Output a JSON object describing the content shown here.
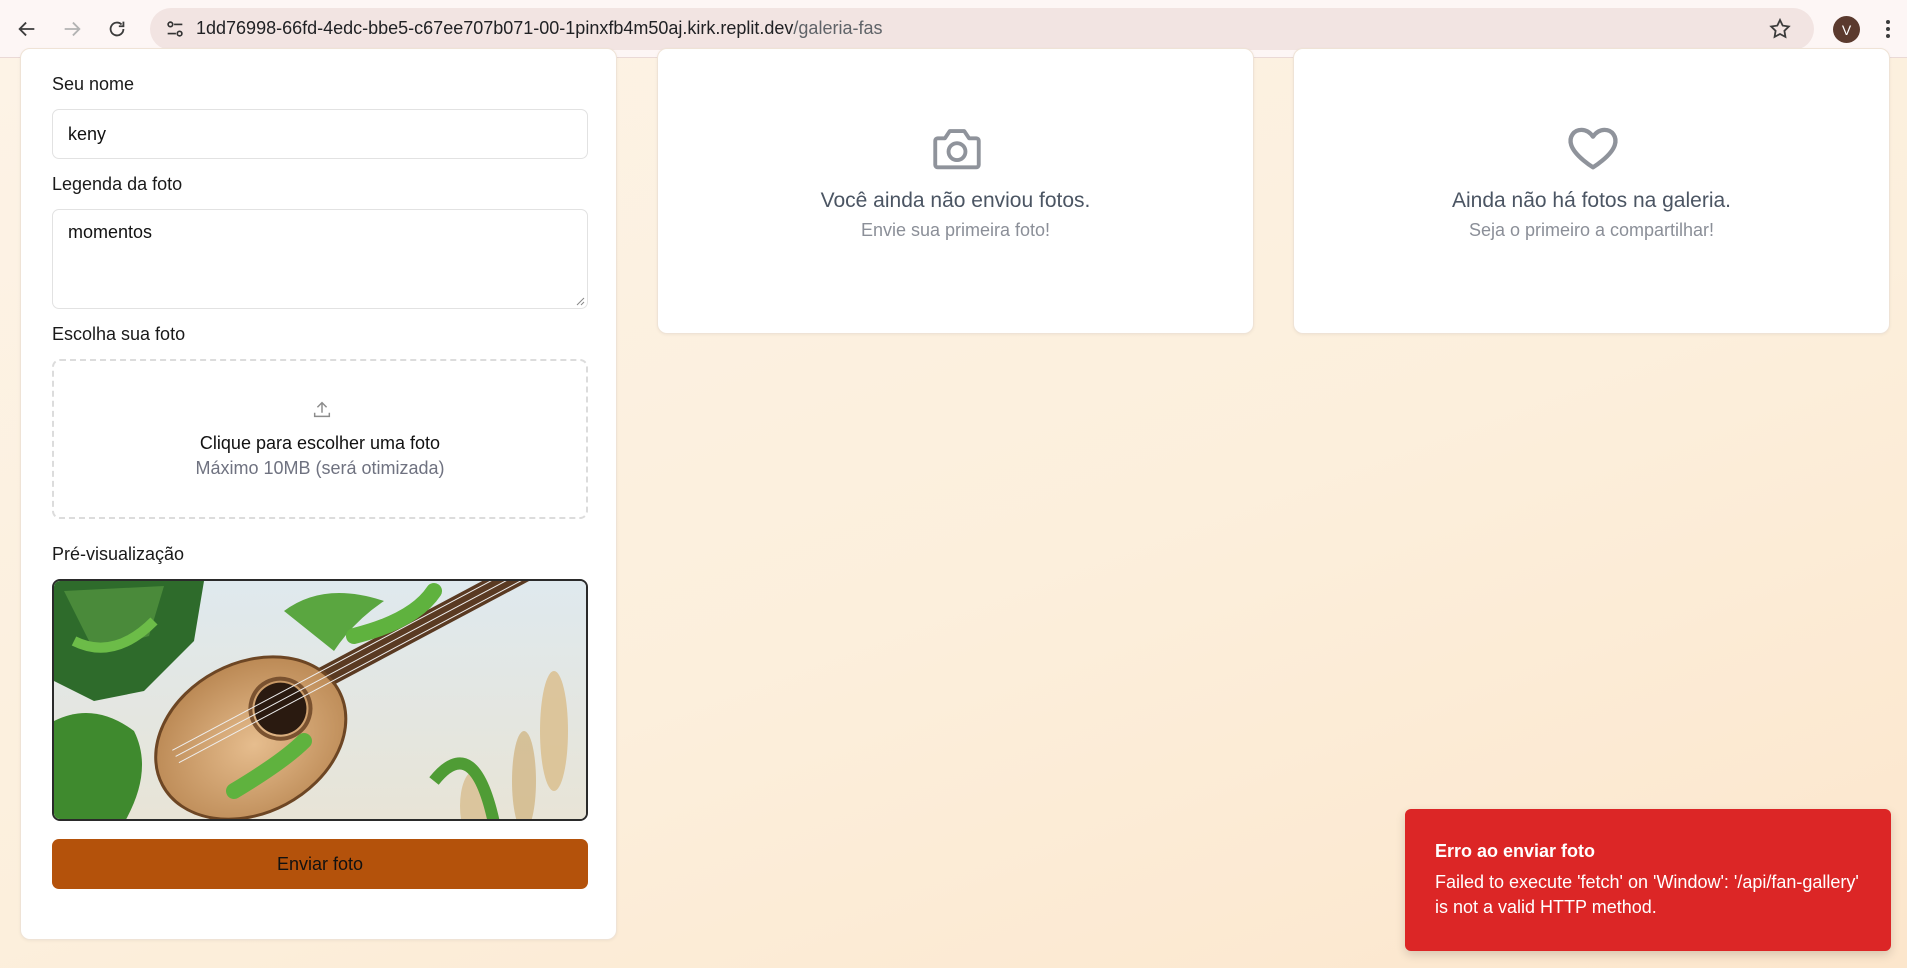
{
  "browser": {
    "url_host": "1dd76998-66fd-4edc-bbe5-c67ee707b071-00-1pinxfb4m50aj.kirk.replit.dev",
    "url_path": "/galeria-fas",
    "profile_initial": "V"
  },
  "form": {
    "name_label": "Seu nome",
    "name_value": "keny",
    "caption_label": "Legenda da foto",
    "caption_value": "momentos",
    "file_label": "Escolha sua foto",
    "dropzone_title": "Clique para escolher uma foto",
    "dropzone_subtitle": "Máximo 10MB (será otimizada)",
    "preview_label": "Pré-visualização",
    "submit_label": "Enviar foto"
  },
  "my_photos": {
    "icon": "camera-icon",
    "title": "Você ainda não enviou fotos.",
    "subtitle": "Envie sua primeira foto!"
  },
  "gallery": {
    "icon": "heart-icon",
    "title": "Ainda não há fotos na galeria.",
    "subtitle": "Seja o primeiro a compartilhar!"
  },
  "toast": {
    "title": "Erro ao enviar foto",
    "message": "Failed to execute 'fetch' on 'Window': '/api/fan-gallery' is not a valid HTTP method."
  },
  "colors": {
    "accent": "#b4520b",
    "error": "#dc2626"
  }
}
